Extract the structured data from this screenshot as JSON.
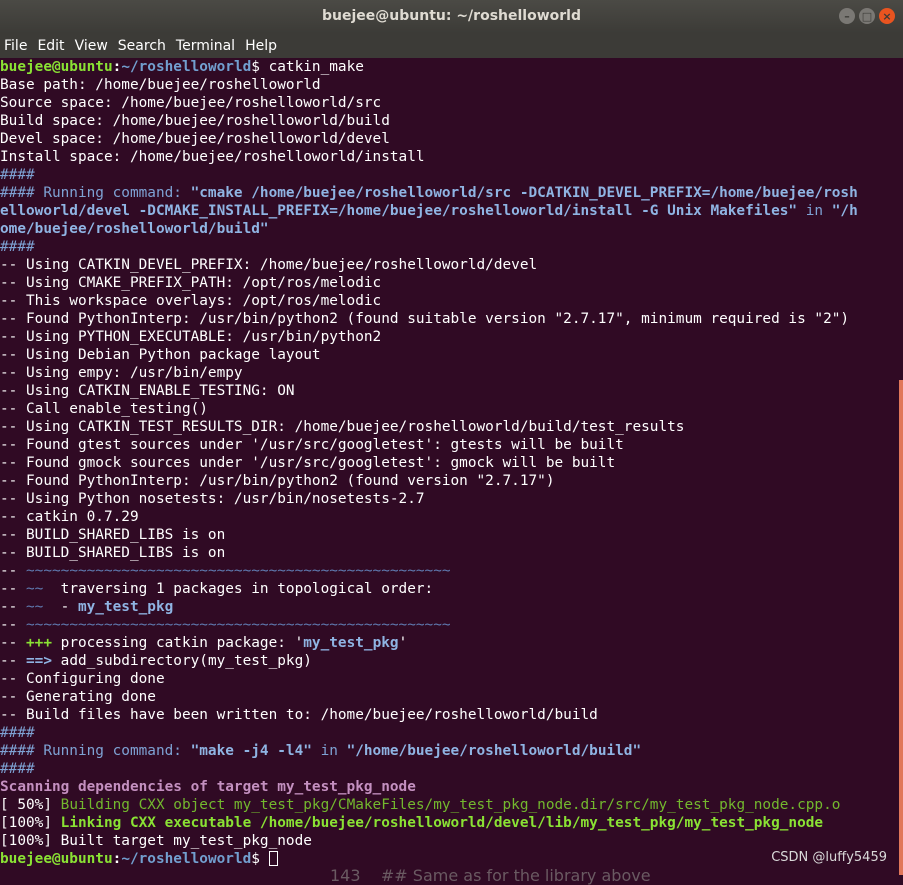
{
  "window": {
    "title": "buejee@ubuntu: ~/roshelloworld"
  },
  "menu": [
    "File",
    "Edit",
    "View",
    "Search",
    "Terminal",
    "Help"
  ],
  "colors": {
    "background": "#300a24",
    "text": "#ffffff",
    "prompt_user": "#8ae234",
    "prompt_path": "#729fcf",
    "blue_bold": "#8fb4e3",
    "blue_dim": "#7ea2d4",
    "tilde": "#5f7ab0",
    "magenta": "#c490c0",
    "green_bold": "#8ae234",
    "green_dim": "#73b82e",
    "scrollbar": "#e1775a"
  },
  "terminal": {
    "lines": [
      [
        {
          "t": "buejee@ubuntu",
          "c": "prompt_user",
          "b": true
        },
        {
          "t": ":",
          "b": true
        },
        {
          "t": "~/roshelloworld",
          "c": "prompt_path",
          "b": true
        },
        {
          "t": "$ catkin_make"
        }
      ],
      [
        {
          "t": "Base path: /home/buejee/roshelloworld"
        }
      ],
      [
        {
          "t": "Source space: /home/buejee/roshelloworld/src"
        }
      ],
      [
        {
          "t": "Build space: /home/buejee/roshelloworld/build"
        }
      ],
      [
        {
          "t": "Devel space: /home/buejee/roshelloworld/devel"
        }
      ],
      [
        {
          "t": "Install space: /home/buejee/roshelloworld/install"
        }
      ],
      [
        {
          "t": "####",
          "c": "blue_dim"
        }
      ],
      [
        {
          "t": "#### Running command: ",
          "c": "blue_dim"
        },
        {
          "t": "\"cmake /home/buejee/roshelloworld/src -DCATKIN_DEVEL_PREFIX=/home/buejee/rosh",
          "c": "blue_bold",
          "b": true
        }
      ],
      [
        {
          "t": "elloworld/devel -DCMAKE_INSTALL_PREFIX=/home/buejee/roshelloworld/install -G Unix Makefiles\"",
          "c": "blue_bold",
          "b": true
        },
        {
          "t": " in ",
          "c": "blue_dim"
        },
        {
          "t": "\"/h",
          "c": "blue_bold",
          "b": true
        }
      ],
      [
        {
          "t": "ome/buejee/roshelloworld/build\"",
          "c": "blue_bold",
          "b": true
        }
      ],
      [
        {
          "t": "####",
          "c": "blue_dim"
        }
      ],
      [
        {
          "t": "-- Using CATKIN_DEVEL_PREFIX: /home/buejee/roshelloworld/devel"
        }
      ],
      [
        {
          "t": "-- Using CMAKE_PREFIX_PATH: /opt/ros/melodic"
        }
      ],
      [
        {
          "t": "-- This workspace overlays: /opt/ros/melodic"
        }
      ],
      [
        {
          "t": "-- Found PythonInterp: /usr/bin/python2 (found suitable version \"2.7.17\", minimum required is \"2\")"
        }
      ],
      [
        {
          "t": "-- Using PYTHON_EXECUTABLE: /usr/bin/python2"
        }
      ],
      [
        {
          "t": "-- Using Debian Python package layout"
        }
      ],
      [
        {
          "t": "-- Using empy: /usr/bin/empy"
        }
      ],
      [
        {
          "t": "-- Using CATKIN_ENABLE_TESTING: ON"
        }
      ],
      [
        {
          "t": "-- Call enable_testing()"
        }
      ],
      [
        {
          "t": "-- Using CATKIN_TEST_RESULTS_DIR: /home/buejee/roshelloworld/build/test_results"
        }
      ],
      [
        {
          "t": "-- Found gtest sources under '/usr/src/googletest': gtests will be built"
        }
      ],
      [
        {
          "t": "-- Found gmock sources under '/usr/src/googletest': gmock will be built"
        }
      ],
      [
        {
          "t": "-- Found PythonInterp: /usr/bin/python2 (found version \"2.7.17\")"
        }
      ],
      [
        {
          "t": "-- Using Python nosetests: /usr/bin/nosetests-2.7"
        }
      ],
      [
        {
          "t": "-- catkin 0.7.29"
        }
      ],
      [
        {
          "t": "-- BUILD_SHARED_LIBS is on"
        }
      ],
      [
        {
          "t": "-- BUILD_SHARED_LIBS is on"
        }
      ],
      [
        {
          "t": "-- "
        },
        {
          "t": "~~~~~~~~~~~~~~~~~~~~~~~~~~~~~~~~~~~~~~~~~~~~~~~~~",
          "c": "tilde"
        }
      ],
      [
        {
          "t": "-- "
        },
        {
          "t": "~~",
          "c": "tilde"
        },
        {
          "t": "  traversing 1 packages in topological order:"
        }
      ],
      [
        {
          "t": "-- "
        },
        {
          "t": "~~",
          "c": "tilde"
        },
        {
          "t": "  - "
        },
        {
          "t": "my_test_pkg",
          "c": "blue_bold",
          "b": true
        }
      ],
      [
        {
          "t": "-- "
        },
        {
          "t": "~~~~~~~~~~~~~~~~~~~~~~~~~~~~~~~~~~~~~~~~~~~~~~~~~",
          "c": "tilde"
        }
      ],
      [
        {
          "t": "-- "
        },
        {
          "t": "+++",
          "c": "green_bold",
          "b": true
        },
        {
          "t": " processing catkin package: '"
        },
        {
          "t": "my_test_pkg",
          "c": "blue_bold",
          "b": true
        },
        {
          "t": "'"
        }
      ],
      [
        {
          "t": "-- "
        },
        {
          "t": "==>",
          "c": "blue_bold",
          "b": true
        },
        {
          "t": " add_subdirectory(my_test_pkg)"
        }
      ],
      [
        {
          "t": "-- Configuring done"
        }
      ],
      [
        {
          "t": "-- Generating done"
        }
      ],
      [
        {
          "t": "-- Build files have been written to: /home/buejee/roshelloworld/build"
        }
      ],
      [
        {
          "t": "####",
          "c": "blue_dim"
        }
      ],
      [
        {
          "t": "#### Running command: ",
          "c": "blue_dim"
        },
        {
          "t": "\"make -j4 -l4\"",
          "c": "blue_bold",
          "b": true
        },
        {
          "t": " in ",
          "c": "blue_dim"
        },
        {
          "t": "\"/home/buejee/roshelloworld/build\"",
          "c": "blue_bold",
          "b": true
        }
      ],
      [
        {
          "t": "####",
          "c": "blue_dim"
        }
      ],
      [
        {
          "t": "Scanning dependencies of target my_test_pkg_node",
          "c": "magenta",
          "b": true
        }
      ],
      [
        {
          "t": "[ 50%] "
        },
        {
          "t": "Building CXX object my_test_pkg/CMakeFiles/my_test_pkg_node.dir/src/my_test_pkg_node.cpp.o",
          "c": "green_dim"
        }
      ],
      [
        {
          "t": "[100%] "
        },
        {
          "t": "Linking CXX executable /home/buejee/roshelloworld/devel/lib/my_test_pkg/my_test_pkg_node",
          "c": "green_bold",
          "b": true
        }
      ],
      [
        {
          "t": "[100%] Built target my_test_pkg_node"
        }
      ],
      [
        {
          "t": "buejee@ubuntu",
          "c": "prompt_user",
          "b": true
        },
        {
          "t": ":",
          "b": true
        },
        {
          "t": "~/roshelloworld",
          "c": "prompt_path",
          "b": true
        },
        {
          "t": "$ "
        },
        {
          "cursor": true
        }
      ]
    ]
  },
  "watermark": "CSDN @luffy5459",
  "background_fragment": "143    ## Same as for the library above"
}
